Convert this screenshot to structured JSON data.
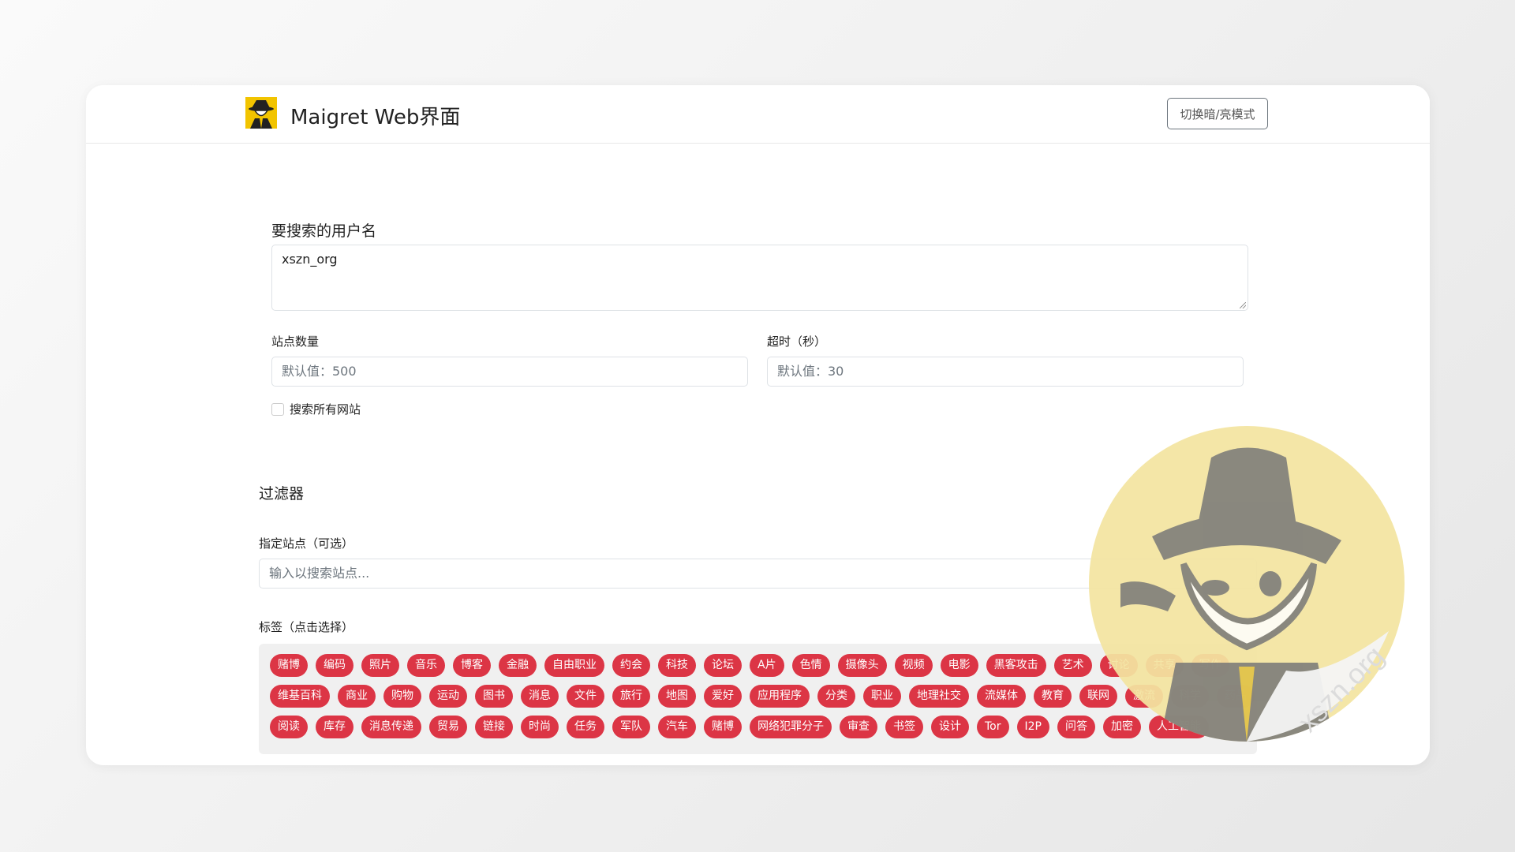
{
  "header": {
    "title": "Maigret Web界面",
    "toggle_label": "切换暗/亮模式"
  },
  "search": {
    "username_label": "要搜索的用户名",
    "username_value": "xszn_org",
    "sites_count_label": "站点数量",
    "sites_count_placeholder": "默认值：500",
    "timeout_label": "超时（秒）",
    "timeout_placeholder": "默认值：30",
    "all_sites_label": "搜索所有网站"
  },
  "filters": {
    "heading": "过滤器",
    "specific_sites_label": "指定站点（可选）",
    "specific_sites_placeholder": "输入以搜索站点...",
    "tags_label": "标签（点击选择）",
    "tag_rows": [
      [
        "赌博",
        "编码",
        "照片",
        "音乐",
        "博客",
        "金融",
        "自由职业",
        "约会",
        "科技",
        "论坛",
        "A片",
        "色情",
        "摄像头",
        "视频",
        "电影",
        "黑客攻击",
        "艺术",
        "讨论",
        "共享",
        "写作"
      ],
      [
        "维基百科",
        "商业",
        "购物",
        "运动",
        "图书",
        "消息",
        "文件",
        "旅行",
        "地图",
        "爱好",
        "应用程序",
        "分类",
        "职业",
        "地理社交",
        "流媒体",
        "教育",
        "联网",
        "激流",
        "科学",
        "药品"
      ],
      [
        "阅读",
        "库存",
        "消息传递",
        "贸易",
        "链接",
        "时尚",
        "任务",
        "军队",
        "汽车",
        "赌博",
        "网络犯罪分子",
        "审查",
        "书签",
        "设计",
        "Tor",
        "I2P",
        "问答",
        "加密",
        "人工智能"
      ]
    ]
  },
  "watermark": {
    "text": "xszn.org"
  },
  "colors": {
    "tag_bg": "#dc3545",
    "sticker_yellow": "#f3e4a0",
    "logo_yellow": "#f2c400"
  }
}
